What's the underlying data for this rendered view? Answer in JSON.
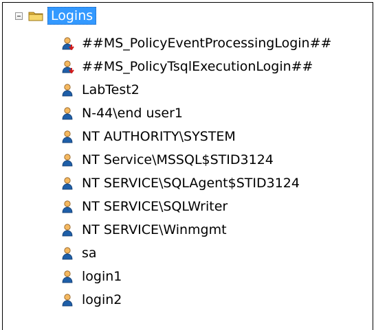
{
  "tree": {
    "root": {
      "label": "Logins",
      "expander": "collapse-minus",
      "icon": "folder-icon",
      "selected": true
    },
    "items": [
      {
        "label": "##MS_PolicyEventProcessingLogin##",
        "icon": "login-disabled-icon"
      },
      {
        "label": "##MS_PolicyTsqlExecutionLogin##",
        "icon": "login-disabled-icon"
      },
      {
        "label": "LabTest2",
        "icon": "login-icon"
      },
      {
        "label": "N-44\\end user1",
        "icon": "login-icon"
      },
      {
        "label": "NT AUTHORITY\\SYSTEM",
        "icon": "login-icon"
      },
      {
        "label": "NT Service\\MSSQL$STID3124",
        "icon": "login-icon"
      },
      {
        "label": "NT SERVICE\\SQLAgent$STID3124",
        "icon": "login-icon"
      },
      {
        "label": "NT SERVICE\\SQLWriter",
        "icon": "login-icon"
      },
      {
        "label": "NT SERVICE\\Winmgmt",
        "icon": "login-icon"
      },
      {
        "label": "sa",
        "icon": "login-icon"
      },
      {
        "label": "login1",
        "icon": "login-icon"
      },
      {
        "label": "login2",
        "icon": "login-icon"
      }
    ]
  },
  "colors": {
    "selection": "#3399ff",
    "user_head": "#f4b860",
    "user_body": "#1f5fa8",
    "disabled_arrow": "#d11a1a",
    "folder": "#f3cf5d"
  }
}
